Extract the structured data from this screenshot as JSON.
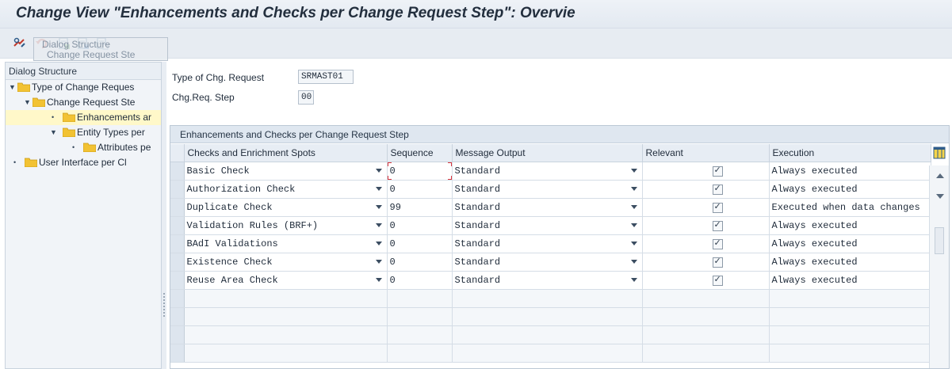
{
  "window": {
    "title": "Change View \"Enhancements and Checks per Change Request Step\": Overvie"
  },
  "toolbar": {
    "icons": [
      "display-change-icon",
      "undo-icon",
      "select-all-icon",
      "select-block-icon",
      "deselect-all-icon"
    ]
  },
  "dialog_structure": {
    "header": "Dialog Structure",
    "drag_ghost": {
      "line1": "Dialog Structure",
      "line2": "Change Request Ste"
    },
    "items": [
      {
        "label": "Type of Change Reques",
        "level": 0,
        "toggle": "▼"
      },
      {
        "label": "Change Request Ste",
        "level": 1,
        "toggle": "▼"
      },
      {
        "label": "Enhancements ar",
        "level": 2,
        "toggle": "•",
        "selected": true
      },
      {
        "label": "Entity Types per",
        "level": 2,
        "toggle": "▼"
      },
      {
        "label": "Attributes pe",
        "level": 3,
        "toggle": "•"
      },
      {
        "label": "User Interface per Cl",
        "level": 0,
        "toggle": "•"
      }
    ]
  },
  "header_fields": {
    "type_label": "Type of Chg. Request",
    "type_value": "SRMAST01",
    "step_label": "Chg.Req. Step",
    "step_value": "00"
  },
  "table": {
    "title": "Enhancements and Checks per Change Request Step",
    "columns": [
      "Checks and Enrichment Spots",
      "Sequence",
      "Message Output",
      "Relevant",
      "Execution"
    ],
    "rows": [
      {
        "check": "Basic Check",
        "sequence": "0",
        "message": "Standard",
        "relevant": true,
        "execution": "Always executed"
      },
      {
        "check": "Authorization Check",
        "sequence": "0",
        "message": "Standard",
        "relevant": true,
        "execution": "Always executed"
      },
      {
        "check": "Duplicate Check",
        "sequence": "99",
        "message": "Standard",
        "relevant": true,
        "execution": "Executed when data changes"
      },
      {
        "check": "Validation Rules (BRF+)",
        "sequence": "0",
        "message": "Standard",
        "relevant": true,
        "execution": "Always executed"
      },
      {
        "check": "BAdI Validations",
        "sequence": "0",
        "message": "Standard",
        "relevant": true,
        "execution": "Always executed"
      },
      {
        "check": "Existence Check",
        "sequence": "0",
        "message": "Standard",
        "relevant": true,
        "execution": "Always executed"
      },
      {
        "check": "Reuse Area Check",
        "sequence": "0",
        "message": "Standard",
        "relevant": true,
        "execution": "Always executed"
      }
    ]
  },
  "colors": {
    "folder": "#f2c233",
    "selected_row": "#fff8c9",
    "focus_marker": "#d9363e"
  }
}
